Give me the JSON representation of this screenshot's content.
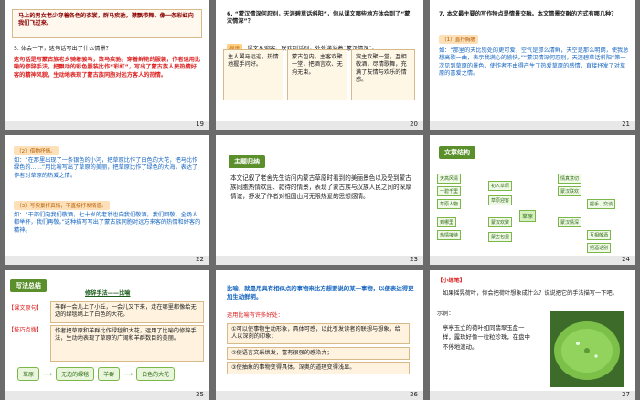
{
  "slides": [
    {
      "num": "19",
      "quote": "马上的男女老少穿着各色的衣裳，群马疾驰，襟飘带舞，像一条彩虹向我们飞过来。",
      "question": "5. 体会一下，这句话写出了什么情景？",
      "answer": "这句话是写蒙古族老乡骑着骏马，策马疾驰，穿着鲜艳的服装，作者运用比喻的修辞手法，把飘动的彩色服装比作“彩虹”，写出了蒙古族人民热情好客的精神风貌，生动地表现了蒙古族同胞对远方客人的热情。"
    },
    {
      "num": "20",
      "question": "6. “蒙汉情深何忍别，天涯碧草话斜阳”，你从课文哪些地方体会到了“蒙汉情深”？",
      "tip_label": "提示",
      "tip": "课文从迎客、联欢到话别，处处洋溢着“蒙汉情深”。",
      "cells": [
        "主人翼马远迎，热情地握手问好。",
        "蒙古包内，主客欢聚一堂，把酒言欢、无拘无束。",
        "宾主欢聚一堂，互相敬酒，尽情歌舞，充满了友情与欢乐的情感。"
      ]
    },
    {
      "num": "21",
      "question": "7. 本文最主要的写作特点是情景交融。本文情景交融的方式有哪几种？",
      "tag": "（1）直抒胸臆",
      "answer": "如：“那里的天比别处的更可爱，空气是那么清鲜，天空是那么明朗，使我总想高歌一曲，表示我满心的愉快。”“蒙汉情深何忍别，天涯碧草话斜阳”第一次见到草原的景色，使作者不由得产生了热爱草原的感情，直接抒发了对草原的喜爱之情。"
    },
    {
      "num": "22",
      "tag1": "（2）借物抒情。",
      "text1": "如：“在那里出现了一条银色的小河，把草原比作了白色的大花，把马比作绿色的……”用比喻写出了草原的美丽，把草原比作了绿色的大海，表达了作者对草原的热爱之情。",
      "tag2": "（3）写实景抒真情，不直接抒发情感。",
      "text2": "如：“干部们向我们敬酒，七十岁的老翁也向我们敬酒。我们回敬，全场人都举杯，我们再敬。”这种描写写出了蒙古族同胞对远方来客的热情和好客的精神。"
    },
    {
      "num": "23",
      "header": "主题归纳",
      "text": "本文记叙了老舍先生访问内蒙古草原时看到的美丽景色以及受到蒙古族同胞热情欢迎、款待的情景，表现了蒙古族与汉族人民之间的深厚情谊，抒发了作者对祖国山河无限热爱的思想感情。"
    },
    {
      "num": "24",
      "header": "文章结构",
      "center": "草原",
      "nodes": [
        "初入草原",
        "草原迎客",
        "蒙汉欢聚",
        "蒙古包里",
        "天高风清",
        "一碧千里",
        "草原人物",
        "到哪里",
        "热情接待",
        "情真意切",
        "蒙汉联欢",
        "握手、交谈",
        "蒙汉情深",
        "互相敬酒",
        "把酒话别"
      ]
    },
    {
      "num": "25",
      "header": "写法总结",
      "title": "修辞手法——比喻",
      "label1": "【课文原句】",
      "quote1": "羊群一会儿上了小丘，一会儿又下来，走在哪里都像给无边的绿毯绣上了白色的大花。",
      "label2": "【技巧点拨】",
      "tip": "作者把草原和羊群比作绿毯和大花，运用了比喻的修辞手法，生动地表现了草原的广阔和羊群数目的美丽。",
      "flow": [
        "草原",
        "无边的绿毯",
        "羊群",
        "白色的大花"
      ]
    },
    {
      "num": "26",
      "text": "比喻，就是用具有相似点的事物来比方想要说的某一事物，以便表达得更加生动鲜明。",
      "subhead": "运用比喻有许多好处：",
      "points": [
        "①可以使事物生动形象，具体可感，以此引发读者的联想与想象，给人以深刻的印象；",
        "②使语言文采焕发，富有很强的感染力；",
        "③使抽象的事物变得具体，深奥的道理变得浅显。"
      ]
    },
    {
      "num": "27",
      "tag": "【小练笔】",
      "text": "如果摇晃荷叶，你会把荷叶想象成什么？说说把它的手法描写一下吧。",
      "example_label": "示例：",
      "example": "亭亭玉立的荷叶如同翡翠玉盘一样，露珠好像一粒粒珍珠，在盘中不停地滚动。"
    }
  ]
}
